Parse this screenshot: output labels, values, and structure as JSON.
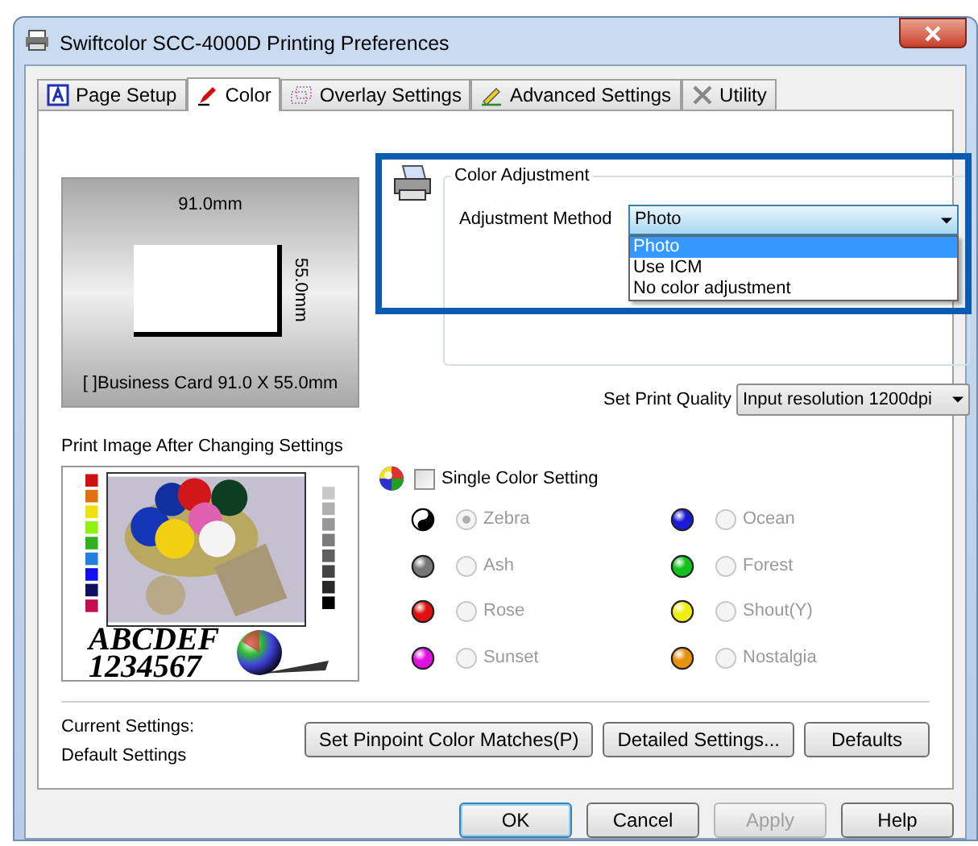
{
  "window": {
    "title": "Swiftcolor SCC-4000D Printing Preferences"
  },
  "tabs": [
    {
      "label": "Page Setup",
      "selected": false,
      "kind": "page"
    },
    {
      "label": "Color",
      "selected": true,
      "kind": "pen"
    },
    {
      "label": "Overlay Settings",
      "selected": false,
      "kind": "overlay"
    },
    {
      "label": "Advanced Settings",
      "selected": false,
      "kind": "pencil"
    },
    {
      "label": "Utility",
      "selected": false,
      "kind": "tools"
    }
  ],
  "preview": {
    "width": "91.0mm",
    "height": "55.0mm",
    "caption": "[ ]Business Card 91.0 X 55.0mm"
  },
  "sample": {
    "label": "Print Image After Changing Settings",
    "text_lines": [
      "ABCDEF",
      "1234567"
    ]
  },
  "color_adjustment": {
    "title": "Color Adjustment",
    "method_label": "Adjustment Method",
    "value": "Photo",
    "expanded": true,
    "options": [
      {
        "label": "Photo",
        "selected": true
      },
      {
        "label": "Use ICM",
        "selected": false
      },
      {
        "label": "No color adjustment",
        "selected": false
      }
    ]
  },
  "print_quality": {
    "label": "Set Print Quality",
    "value": "Input resolution 1200dpi"
  },
  "single_color": {
    "label": "Single Color Setting",
    "checked": false
  },
  "color_modes": [
    {
      "label": "Zebra",
      "selected": true,
      "disabled": true,
      "kind": "split",
      "color": "#000000"
    },
    {
      "label": "Ocean",
      "selected": false,
      "disabled": true,
      "kind": "ball",
      "color": "#1a1ad8"
    },
    {
      "label": "Ash",
      "selected": false,
      "disabled": true,
      "kind": "ball",
      "color": "#777777"
    },
    {
      "label": "Forest",
      "selected": false,
      "disabled": true,
      "kind": "ball",
      "color": "#12c21a"
    },
    {
      "label": "Rose",
      "selected": false,
      "disabled": true,
      "kind": "ball",
      "color": "#e01010"
    },
    {
      "label": "Shout(Y)",
      "selected": false,
      "disabled": true,
      "kind": "ball",
      "color": "#eeee10"
    },
    {
      "label": "Sunset",
      "selected": false,
      "disabled": true,
      "kind": "ball",
      "color": "#e010e0"
    },
    {
      "label": "Nostalgia",
      "selected": false,
      "disabled": true,
      "kind": "ball",
      "color": "#e89010"
    }
  ],
  "current_settings": {
    "label": "Current Settings:",
    "value": "Default Settings"
  },
  "panel_buttons": [
    "Set Pinpoint Color Matches(P)",
    "Detailed Settings...",
    "Defaults"
  ],
  "dialog_buttons": [
    {
      "label": "OK",
      "default": true,
      "disabled": false
    },
    {
      "label": "Cancel",
      "default": false,
      "disabled": false
    },
    {
      "label": "Apply",
      "default": false,
      "disabled": true
    },
    {
      "label": "Help",
      "default": false,
      "disabled": false
    }
  ]
}
